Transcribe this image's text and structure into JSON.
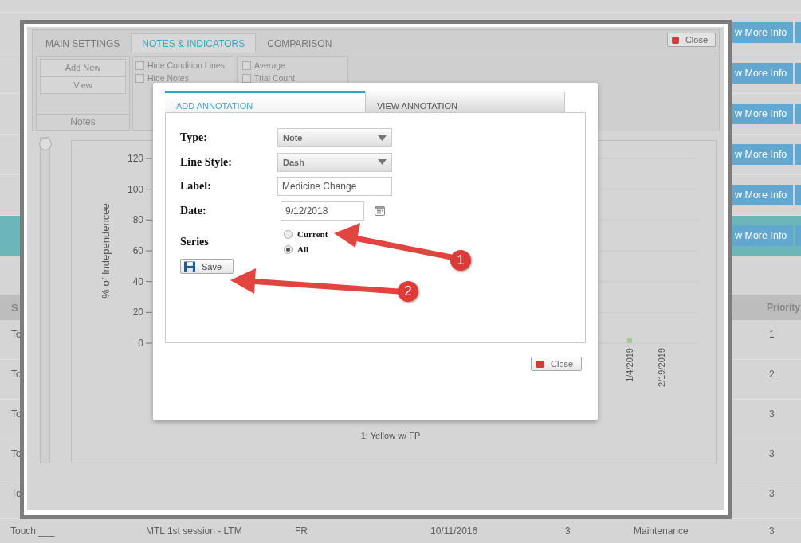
{
  "background_page": {
    "side_rows": [
      {
        "button": "w More Info",
        "selected": false
      },
      {
        "button": "w More Info",
        "selected": false
      },
      {
        "button": "w More Info",
        "selected": false
      },
      {
        "button": "w More Info",
        "selected": false
      },
      {
        "button": "w More Info",
        "selected": false
      },
      {
        "button": "w More Info",
        "selected": true
      }
    ],
    "table": {
      "columns": [
        "S",
        "Priority"
      ],
      "rows": [
        {
          "first": "To",
          "last": "1"
        },
        {
          "first": "To",
          "last": "2"
        },
        {
          "first": "To",
          "last": "3"
        },
        {
          "first": "To",
          "last": "3"
        },
        {
          "first": "To",
          "last": "3"
        }
      ],
      "bottom_row": [
        "Touch ___",
        "MTL 1st session - LTM",
        "FR",
        "10/11/2016",
        "3",
        "Maintenance",
        "3"
      ]
    }
  },
  "modal": {
    "tabs": [
      {
        "label": "MAIN SETTINGS",
        "selected": false
      },
      {
        "label": "NOTES & INDICATORS",
        "selected": true
      },
      {
        "label": "COMPARISON",
        "selected": false
      }
    ],
    "close_button": "Close",
    "notes_group": {
      "buttons": [
        "Add New",
        "View"
      ],
      "footer": "Notes"
    },
    "checkbox_groups": [
      [
        {
          "label": "Hide Condition Lines",
          "checked": false
        },
        {
          "label": "Hide Notes",
          "checked": false
        }
      ],
      [
        {
          "label": "Average",
          "checked": false
        },
        {
          "label": "Trial Count",
          "checked": false
        }
      ]
    ],
    "slider": {
      "level": 0
    },
    "chart": {
      "y_axis_title": "% of Independencee",
      "y_tick_labels": [
        "120",
        "100",
        "80",
        "60",
        "40",
        "20",
        "0"
      ],
      "x_tick_labels": [
        "1/4/2019",
        "2/19/2019"
      ],
      "legend": "1: Yellow w/ FP"
    }
  },
  "dialog": {
    "tabs": [
      {
        "label": "ADD ANNOTATION",
        "selected": true
      },
      {
        "label": "VIEW ANNOTATION",
        "selected": false
      }
    ],
    "fields": [
      {
        "kind": "select",
        "label": "Type:",
        "value": "Note"
      },
      {
        "kind": "select",
        "label": "Line Style:",
        "value": "Dash"
      },
      {
        "kind": "text",
        "label": "Label:",
        "value": "Medicine Change"
      },
      {
        "kind": "date",
        "label": "Date:",
        "value": "9/12/2018"
      }
    ],
    "series": {
      "label": "Series",
      "options": [
        {
          "label": "Current",
          "selected": false
        },
        {
          "label": "All",
          "selected": true
        }
      ]
    },
    "save_button": "Save",
    "close_button": "Close"
  },
  "callouts": [
    {
      "number": "1"
    },
    {
      "number": "2"
    }
  ]
}
